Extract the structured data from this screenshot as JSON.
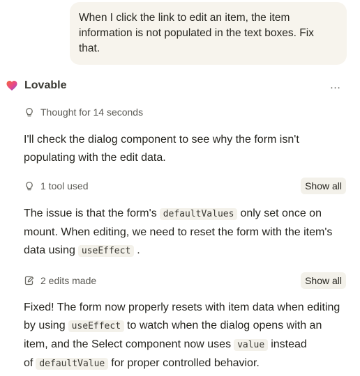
{
  "user_message": {
    "text": "When I click the link to edit an item, the item information is not populated in the text boxes. Fix that."
  },
  "assistant": {
    "name": "Lovable",
    "more_label": "…"
  },
  "thought": {
    "label": "Thought for 14 seconds"
  },
  "message1": {
    "text": "I'll check the dialog component to see why the form isn't populating with the edit data."
  },
  "tools": {
    "label": "1 tool used",
    "show_all": "Show all"
  },
  "message2": {
    "t1": "The issue is that the form's",
    "c1": "defaultValues",
    "t2": "only set once on mount. When editing, we need to reset the form with the item's data using",
    "c2": "useEffect",
    "t3": "."
  },
  "edits": {
    "label": "2 edits made",
    "show_all": "Show all"
  },
  "message3": {
    "t1": "Fixed! The form now properly resets with item data when editing by using",
    "c1": "useEffect",
    "t2": "to watch when the dialog opens with an item, and the Select component now uses",
    "c2": "value",
    "t3": "instead of",
    "c3": "defaultValue",
    "t4": "for proper controlled behavior."
  },
  "colors": {
    "bubble_bg": "#f7f4ed",
    "code_bg": "#f3f1ea",
    "logo_orange": "#f26b3a",
    "logo_pink": "#e8468a",
    "logo_purple": "#6f5bd9"
  }
}
